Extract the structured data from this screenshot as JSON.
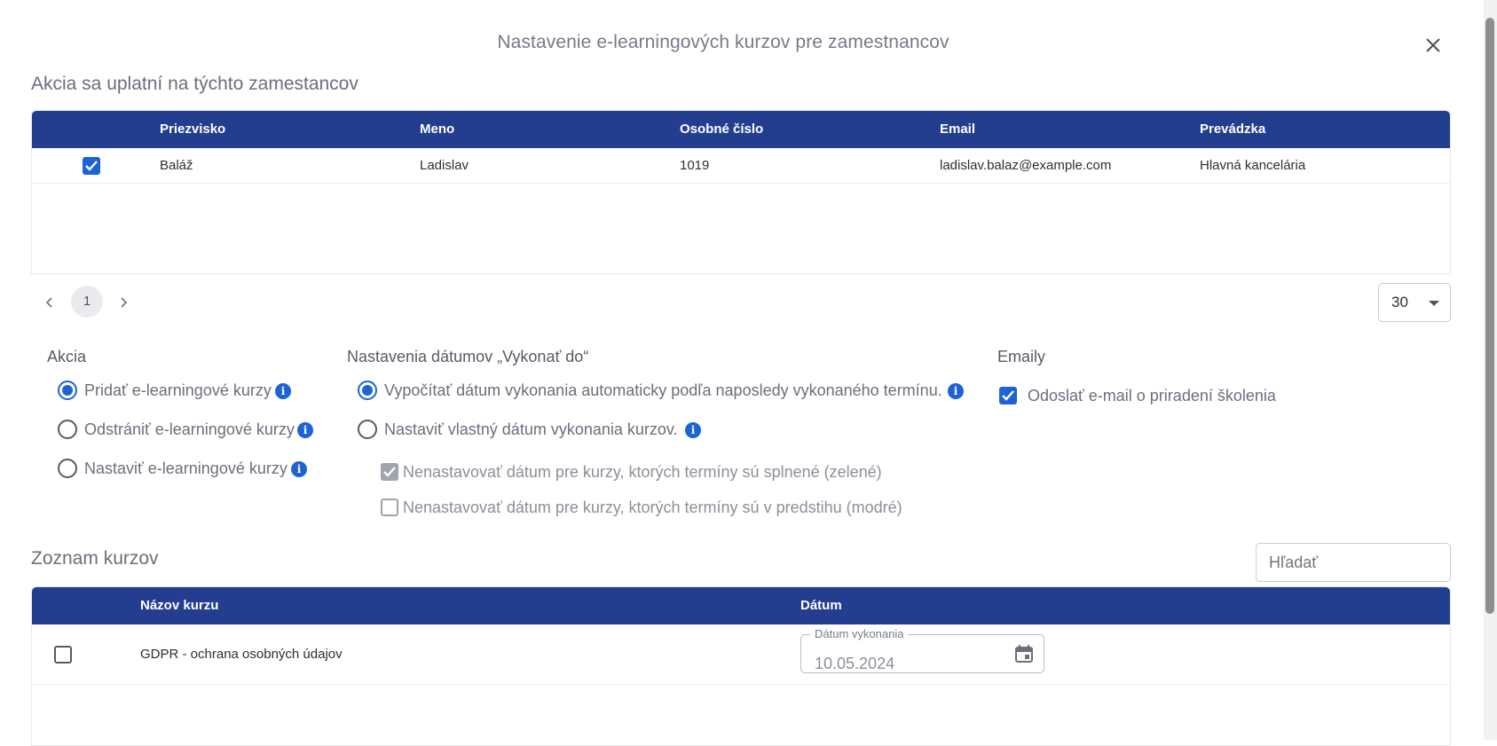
{
  "dialog": {
    "title": "Nastavenie e-learningových kurzov pre zamestnancov"
  },
  "employees": {
    "section_title": "Akcia sa uplatní na týchto zamestancov",
    "columns": [
      "Priezvisko",
      "Meno",
      "Osobné číslo",
      "Email",
      "Prevádzka"
    ],
    "rows": [
      {
        "checked": true,
        "surname": "Baláž",
        "name": "Ladislav",
        "personal_number": "1019",
        "email": "ladislav.balaz@example.com",
        "branch": "Hlavná kancelária"
      }
    ],
    "pager": {
      "current_page": "1",
      "page_size": "30"
    }
  },
  "action": {
    "title": "Akcia",
    "options": [
      {
        "label": "Pridať e-learningové kurzy",
        "selected": true
      },
      {
        "label": "Odstrániť e-learningové kurzy",
        "selected": false
      },
      {
        "label": "Nastaviť e-learningové kurzy",
        "selected": false
      }
    ]
  },
  "date_settings": {
    "title": "Nastavenia dátumov „Vykonať do“",
    "options": [
      {
        "label": "Vypočítať dátum vykonania automaticky podľa naposledy vykonaného termínu.",
        "selected": true
      },
      {
        "label": "Nastaviť vlastný dátum vykonania kurzov.",
        "selected": false
      }
    ],
    "checkboxes": [
      {
        "label": "Nenastavovať dátum pre kurzy, ktorých termíny sú splnené (zelené)",
        "checked": true,
        "disabled": true
      },
      {
        "label": "Nenastavovať dátum pre kurzy, ktorých termíny sú v predstihu (modré)",
        "checked": false,
        "disabled": true
      }
    ]
  },
  "emails": {
    "title": "Emaily",
    "send_label": "Odoslať e-mail o priradení školenia",
    "checked": true
  },
  "courses": {
    "section_title": "Zoznam kurzov",
    "search_placeholder": "Hľadať",
    "columns": [
      "Názov kurzu",
      "Dátum"
    ],
    "rows": [
      {
        "checked": false,
        "name": "GDPR - ochrana osobných údajov",
        "date_label": "Dátum vykonania",
        "date_value": "10.05.2024"
      }
    ]
  },
  "icons": {
    "close": "close-icon",
    "prev": "chevron-left-icon",
    "next": "chevron-right-icon",
    "dropdown": "caret-down-icon",
    "info": "info-icon",
    "calendar": "calendar-icon",
    "check": "check-icon"
  },
  "colors": {
    "header_bg": "#243e8f",
    "accent": "#1e63d6"
  }
}
